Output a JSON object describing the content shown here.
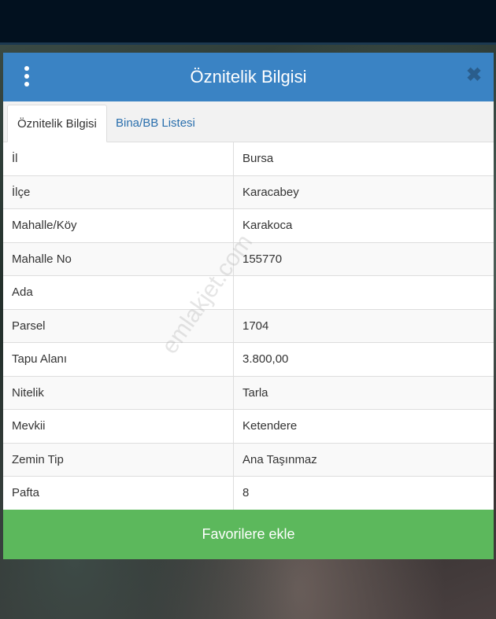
{
  "dialog": {
    "title": "Öznitelik Bilgisi",
    "close_glyph": "✖"
  },
  "tabs": [
    {
      "label": "Öznitelik Bilgisi",
      "active": true
    },
    {
      "label": "Bina/BB Listesi",
      "active": false
    }
  ],
  "attributes": [
    {
      "key": "İl",
      "value": "Bursa"
    },
    {
      "key": "İlçe",
      "value": "Karacabey"
    },
    {
      "key": "Mahalle/Köy",
      "value": "Karakoca"
    },
    {
      "key": "Mahalle No",
      "value": "155770"
    },
    {
      "key": "Ada",
      "value": ""
    },
    {
      "key": "Parsel",
      "value": "1704"
    },
    {
      "key": "Tapu Alanı",
      "value": "3.800,00"
    },
    {
      "key": "Nitelik",
      "value": "Tarla"
    },
    {
      "key": "Mevkii",
      "value": "Ketendere"
    },
    {
      "key": "Zemin Tip",
      "value": "Ana Taşınmaz"
    },
    {
      "key": "Pafta",
      "value": "8"
    }
  ],
  "favorite_button_label": "Favorilere ekle",
  "watermark": "emlakjet.com",
  "colors": {
    "header": "#3a83c4",
    "favorite_button": "#5cb85c",
    "tab_link": "#2a6fad"
  }
}
